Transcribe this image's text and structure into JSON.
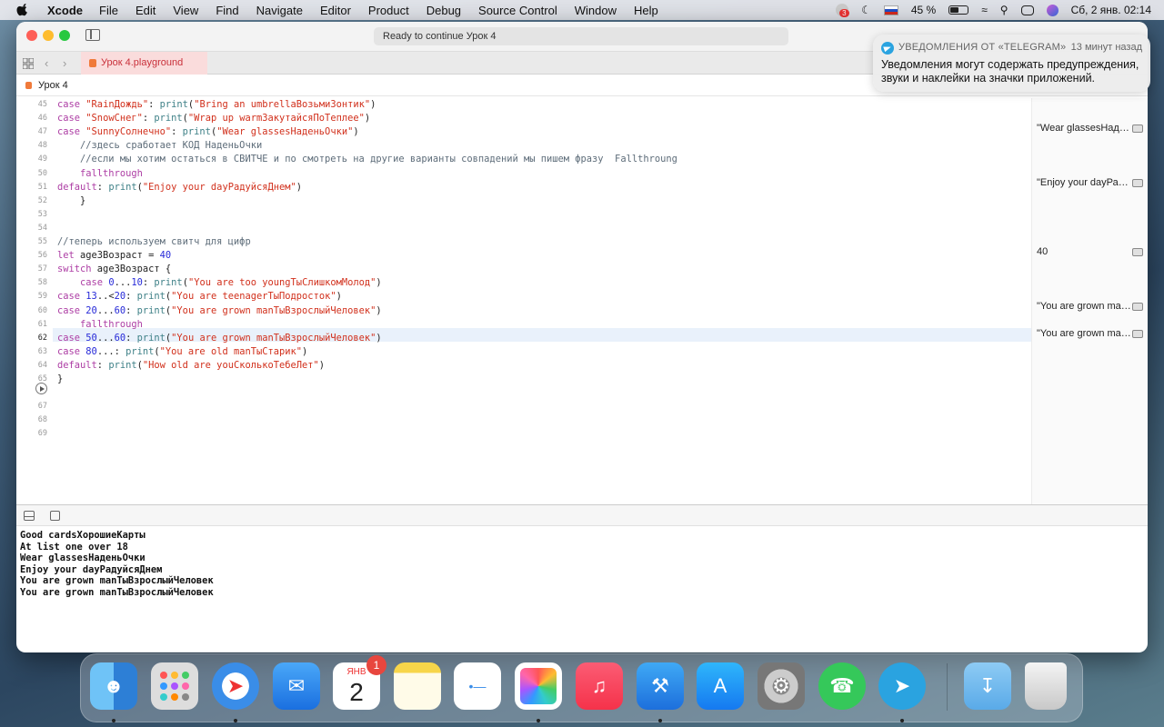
{
  "menubar": {
    "app": "Xcode",
    "items": [
      "File",
      "Edit",
      "View",
      "Find",
      "Navigate",
      "Editor",
      "Product",
      "Debug",
      "Source Control",
      "Window",
      "Help"
    ],
    "notif_badge": "3",
    "battery": "45 %",
    "clock": "Сб, 2 янв.  02:14"
  },
  "window": {
    "status": "Ready to continue Урок 4",
    "tab": "Урок 4.playground",
    "breadcrumb": "Урок 4"
  },
  "editor": {
    "line_numbers": [
      "45",
      "46",
      "47",
      "48",
      "49",
      "50",
      "51",
      "52",
      "53",
      "54",
      "55",
      "56",
      "57",
      "58",
      "59",
      "60",
      "61",
      "62",
      "63",
      "64",
      "65",
      "66",
      "67",
      "68",
      "69"
    ],
    "active_line": "62",
    "lines": [
      "case \"RainДождь\": print(\"Bring an umbrellaВозьмиЗонтик\")",
      "case \"SnowСнег\": print(\"Wrap up warmЗакутайсяПоТеплее\")",
      "case \"SunnyСолнечно\": print(\"Wear glassesНаденьОчки\")",
      "    //здесь сработает КОД НаденьОчки",
      "    //если мы хотим остаться в СВИТЧЕ и по смотреть на другие варианты совпадений мы пишем фразу  Fallthroung",
      "    fallthrough",
      "default: print(\"Enjoy your dayРадуйсяДнем\")",
      "    }",
      "",
      "",
      "//теперь используем свитч для цифр",
      "let age3Возраст = 40",
      "switch age3Возраст {",
      "    case 0...10: print(\"You are too youngТыСлишкомМолод\")",
      "case 13..<20: print(\"You are teenagerТыПодросток\")",
      "case 20...60: print(\"You are grown manТыВзрослыйЧеловек\")",
      "    fallthrough",
      "case 50...60: print(\"You are grown manТыВзрослыйЧеловек\")",
      "case 80...: print(\"You are old manТыСтарик\")",
      "default: print(\"How old are youСколькоТебеЛет\")",
      "}",
      "",
      "",
      "",
      ""
    ]
  },
  "results": {
    "r47": "\"Wear glassesНаденьОчки\\n\"",
    "r51": "\"Enjoy your dayРадуйсяДнем\\n\"",
    "r56": "40",
    "r60": "\"You are grown manТыВзрослыйЧеловек\\n\"",
    "r62": "\"You are grown manТыВзрослыйЧеловек\\n\""
  },
  "console": [
    "Good cardsХорошиеКарты",
    "At list one over 18",
    "Wear glassesНаденьОчки",
    "Enjoy your dayРадуйсяДнем",
    "You are grown manТыВзрослыйЧеловек",
    "You are grown manТыВзрослыйЧеловек"
  ],
  "notification": {
    "app": "УВЕДОМЛЕНИЯ ОТ «TELEGRAM»",
    "time": "13 минут назад",
    "body": "Уведомления могут содержать предупреждения, звуки и наклейки на значки приложений."
  },
  "dock": {
    "calendar_month": "ЯНВ",
    "calendar_day": "2",
    "calendar_badge": "1",
    "apps": [
      "finder-icon",
      "launchpad-icon",
      "safari-icon",
      "mail-icon",
      "calendar-icon",
      "notes-icon",
      "reminders-icon",
      "photos-icon",
      "music-icon",
      "xcode-icon",
      "app-store-icon",
      "system-preferences-icon",
      "whatsapp-icon",
      "telegram-icon",
      "downloads-icon",
      "trash-icon"
    ]
  }
}
